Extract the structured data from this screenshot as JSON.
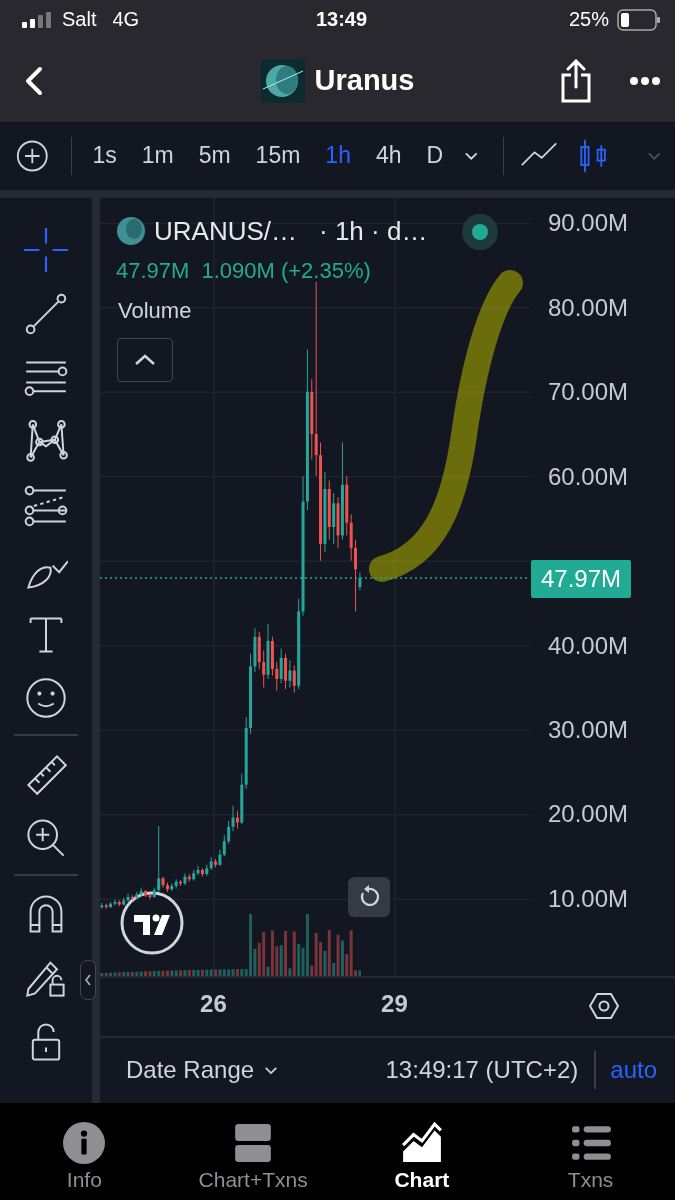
{
  "status_bar": {
    "carrier": "Salt",
    "network": "4G",
    "time": "13:49",
    "battery": "25%"
  },
  "nav": {
    "title": "Uranus"
  },
  "toolbar": {
    "intervals": [
      {
        "label": "1s",
        "selected": false
      },
      {
        "label": "1m",
        "selected": false
      },
      {
        "label": "5m",
        "selected": false
      },
      {
        "label": "15m",
        "selected": false
      },
      {
        "label": "1h",
        "selected": true
      },
      {
        "label": "4h",
        "selected": false
      },
      {
        "label": "D",
        "selected": false
      }
    ],
    "chart_types": [
      {
        "kind": "line",
        "selected": false
      },
      {
        "kind": "candles",
        "selected": true
      }
    ]
  },
  "tool_groups": [
    [
      {
        "kind": "crosshair",
        "selected": true
      },
      {
        "kind": "trendline",
        "selected": false
      },
      {
        "kind": "fib",
        "selected": false
      },
      {
        "kind": "pattern",
        "selected": false
      },
      {
        "kind": "prediction",
        "selected": false
      },
      {
        "kind": "brush",
        "selected": false
      },
      {
        "kind": "text",
        "selected": false
      },
      {
        "kind": "emoji",
        "selected": false
      }
    ],
    [
      {
        "kind": "ruler",
        "selected": false
      },
      {
        "kind": "zoom",
        "selected": false
      }
    ],
    [
      {
        "kind": "magnet",
        "selected": false
      },
      {
        "kind": "lockdraw",
        "selected": false
      },
      {
        "kind": "lock",
        "selected": false
      }
    ]
  ],
  "legend": {
    "symbol": "URANUS/…",
    "interval": "· 1h · d…",
    "price": "47.97M",
    "change": "1.090M (+2.35%)",
    "indicator": "Volume"
  },
  "chart": {
    "current_price": "47.97M",
    "chart_data": {
      "type": "candlestick",
      "ylim": [
        0.9,
        93
      ],
      "xlim": [
        24.11,
        33.64
      ],
      "grid": true,
      "ref_lines": [
        {
          "axis": "y",
          "value": 47.97,
          "color": "#22ab94"
        }
      ],
      "yticks": [
        {
          "value": 90,
          "label": "90.00M"
        },
        {
          "value": 80,
          "label": "80.00M"
        },
        {
          "value": 70,
          "label": "70.00M"
        },
        {
          "value": 60,
          "label": "60.00M"
        },
        {
          "value": 40,
          "label": "40.00M"
        },
        {
          "value": 30,
          "label": "30.00M"
        },
        {
          "value": 20,
          "label": "20.00M"
        },
        {
          "value": 10,
          "label": "10.00M"
        }
      ],
      "xticks": [
        {
          "value": 26,
          "label": "26"
        },
        {
          "value": 29,
          "label": "29"
        }
      ],
      "x": [
        24.14,
        24.213,
        24.285,
        24.358,
        24.43,
        24.503,
        24.575,
        24.648,
        24.72,
        24.793,
        24.865,
        24.938,
        25.01,
        25.083,
        25.155,
        25.228,
        25.3,
        25.373,
        25.445,
        25.518,
        25.59,
        25.663,
        25.735,
        25.808,
        25.88,
        25.953,
        26.025,
        26.098,
        26.17,
        26.243,
        26.315,
        26.388,
        26.46,
        26.533,
        26.605,
        26.678,
        26.75,
        26.823,
        26.895,
        26.968,
        27.04,
        27.113,
        27.185,
        27.258,
        27.33,
        27.403,
        27.475,
        27.548,
        27.62,
        27.693,
        27.765,
        27.838,
        27.91,
        27.983,
        28.055,
        28.128,
        28.2,
        28.273,
        28.345,
        28.418
      ],
      "ohlc": [
        [
          9.0,
          9.5,
          8.8,
          9.2
        ],
        [
          9.2,
          9.4,
          8.8,
          9.0
        ],
        [
          9.0,
          9.6,
          8.9,
          9.4
        ],
        [
          9.4,
          9.9,
          9.2,
          9.6
        ],
        [
          9.6,
          9.8,
          9.1,
          9.3
        ],
        [
          9.3,
          10.1,
          9.2,
          9.8
        ],
        [
          9.8,
          10.6,
          9.6,
          10.2
        ],
        [
          10.2,
          10.4,
          9.8,
          10.0
        ],
        [
          10.0,
          10.8,
          9.9,
          10.5
        ],
        [
          10.5,
          11.3,
          10.3,
          10.9
        ],
        [
          10.9,
          11.0,
          10.2,
          10.4
        ],
        [
          10.4,
          10.6,
          9.9,
          10.2
        ],
        [
          10.2,
          11.3,
          10.1,
          11.0
        ],
        [
          11.0,
          18.6,
          10.8,
          12.4
        ],
        [
          12.4,
          12.6,
          11.3,
          11.6
        ],
        [
          11.6,
          11.9,
          10.8,
          11.1
        ],
        [
          11.1,
          11.8,
          10.9,
          11.5
        ],
        [
          11.5,
          12.3,
          11.2,
          12.0
        ],
        [
          12.0,
          12.2,
          11.5,
          11.8
        ],
        [
          11.8,
          13.0,
          11.6,
          12.6
        ],
        [
          12.6,
          12.9,
          12.0,
          12.3
        ],
        [
          12.3,
          13.4,
          12.1,
          13.0
        ],
        [
          13.0,
          13.9,
          12.8,
          13.4
        ],
        [
          13.4,
          13.6,
          12.6,
          12.9
        ],
        [
          12.9,
          14.0,
          12.7,
          13.6
        ],
        [
          13.6,
          14.9,
          13.4,
          14.4
        ],
        [
          14.4,
          14.7,
          13.7,
          14.0
        ],
        [
          14.0,
          15.8,
          13.9,
          15.2
        ],
        [
          15.2,
          17.5,
          15.0,
          16.8
        ],
        [
          16.8,
          19.2,
          16.5,
          18.5
        ],
        [
          18.5,
          21.0,
          18.0,
          19.6
        ],
        [
          19.6,
          20.4,
          18.3,
          19.0
        ],
        [
          19.0,
          24.8,
          18.8,
          23.5
        ],
        [
          23.5,
          31.5,
          23.0,
          30.2
        ],
        [
          30.2,
          39.0,
          29.5,
          37.5
        ],
        [
          37.5,
          42.0,
          36.8,
          41.0
        ],
        [
          41.0,
          41.6,
          37.2,
          38.0
        ],
        [
          38.0,
          39.4,
          35.0,
          36.5
        ],
        [
          36.5,
          42.5,
          36.0,
          40.5
        ],
        [
          40.5,
          41.0,
          36.4,
          37.2
        ],
        [
          37.2,
          38.0,
          34.6,
          36.0
        ],
        [
          36.0,
          39.6,
          35.5,
          38.5
        ],
        [
          38.5,
          39.0,
          34.8,
          35.8
        ],
        [
          35.8,
          38.2,
          35.0,
          37.0
        ],
        [
          37.0,
          37.6,
          34.4,
          35.2
        ],
        [
          35.2,
          45.5,
          34.8,
          44.0
        ],
        [
          44.0,
          60.0,
          43.5,
          57.0
        ],
        [
          57.0,
          75.0,
          56.0,
          70.0
        ],
        [
          70.0,
          71.5,
          62.0,
          65.0
        ],
        [
          65.0,
          83.0,
          60.0,
          62.5
        ],
        [
          62.5,
          64.0,
          50.0,
          52.0
        ],
        [
          52.0,
          60.5,
          51.0,
          58.5
        ],
        [
          58.5,
          59.5,
          52.5,
          54.0
        ],
        [
          54.0,
          58.0,
          52.0,
          56.8
        ],
        [
          56.8,
          57.5,
          51.5,
          53.0
        ],
        [
          53.0,
          64.0,
          52.5,
          59.0
        ],
        [
          59.0,
          60.0,
          53.0,
          54.5
        ],
        [
          54.5,
          55.5,
          50.0,
          51.5
        ],
        [
          51.5,
          52.5,
          44.0,
          49.0
        ],
        [
          46.9,
          48.6,
          46.5,
          47.97
        ]
      ]
    }
  },
  "footer": {
    "date_range": "Date Range",
    "time": "13:49:17 (UTC+2)",
    "scale": "auto"
  },
  "tabs": [
    {
      "label": "Info",
      "kind": "info",
      "selected": false
    },
    {
      "label": "Chart+Txns",
      "kind": "split",
      "selected": false
    },
    {
      "label": "Chart",
      "kind": "chart",
      "selected": true
    },
    {
      "label": "Txns",
      "kind": "list",
      "selected": false
    }
  ]
}
